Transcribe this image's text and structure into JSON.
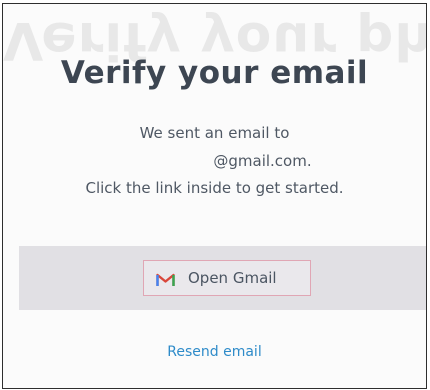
{
  "background_text": "Verify your phone number",
  "title": "Verify your email",
  "message": {
    "line1": "We sent an email to",
    "line2": "@gmail.com.",
    "line3": "Click the link inside to get started."
  },
  "open_gmail": {
    "label": "Open Gmail",
    "icon": "gmail-icon"
  },
  "resend_label": "Resend email",
  "colors": {
    "title": "#3d4652",
    "link": "#2e8bc9",
    "button_border": "#e0a6b4"
  }
}
